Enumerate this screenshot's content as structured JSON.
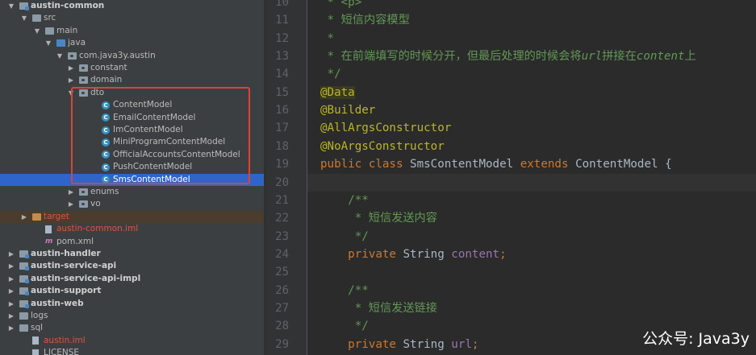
{
  "project_tree": {
    "rows": [
      {
        "label": "austin-common",
        "arrow": "▼",
        "icon": "module",
        "indent": 24,
        "bold": true
      },
      {
        "label": "src",
        "arrow": "▼",
        "icon": "folder",
        "indent": 40
      },
      {
        "label": "main",
        "arrow": "▼",
        "icon": "folder",
        "indent": 56
      },
      {
        "label": "java",
        "arrow": "▼",
        "icon": "src",
        "indent": 70
      },
      {
        "label": "com.java3y.austin",
        "arrow": "▼",
        "icon": "package",
        "indent": 84
      },
      {
        "label": "constant",
        "arrow": "▶",
        "icon": "package",
        "indent": 98
      },
      {
        "label": "domain",
        "arrow": "▶",
        "icon": "package",
        "indent": 98
      },
      {
        "label": "dto",
        "arrow": "▼",
        "icon": "package",
        "indent": 98
      },
      {
        "label": "ContentModel",
        "arrow": "",
        "icon": "java-class",
        "indent": 126
      },
      {
        "label": "EmailContentModel",
        "arrow": "",
        "icon": "java-class",
        "indent": 126
      },
      {
        "label": "ImContentModel",
        "arrow": "",
        "icon": "java-class",
        "indent": 126
      },
      {
        "label": "MiniProgramContentModel",
        "arrow": "",
        "icon": "java-class",
        "indent": 126
      },
      {
        "label": "OfficialAccountsContentModel",
        "arrow": "",
        "icon": "java-class",
        "indent": 126
      },
      {
        "label": "PushContentModel",
        "arrow": "",
        "icon": "java-class",
        "indent": 126
      },
      {
        "label": "SmsContentModel",
        "arrow": "",
        "icon": "java-class",
        "indent": 126,
        "selected": true
      },
      {
        "label": "enums",
        "arrow": "▶",
        "icon": "package",
        "indent": 98
      },
      {
        "label": "vo",
        "arrow": "▶",
        "icon": "package",
        "indent": 98
      },
      {
        "label": "target",
        "arrow": "▶",
        "icon": "target",
        "indent": 40,
        "excluded": true,
        "red": true
      },
      {
        "label": "austin-common.iml",
        "arrow": "",
        "icon": "file",
        "indent": 56,
        "red": true
      },
      {
        "label": "pom.xml",
        "arrow": "",
        "icon": "maven",
        "indent": 56
      },
      {
        "label": "austin-handler",
        "arrow": "▶",
        "icon": "module",
        "indent": 24,
        "bold": true
      },
      {
        "label": "austin-service-api",
        "arrow": "▶",
        "icon": "module",
        "indent": 24,
        "bold": true
      },
      {
        "label": "austin-service-api-impl",
        "arrow": "▶",
        "icon": "module",
        "indent": 24,
        "bold": true
      },
      {
        "label": "austin-support",
        "arrow": "▶",
        "icon": "module",
        "indent": 24,
        "bold": true
      },
      {
        "label": "austin-web",
        "arrow": "▶",
        "icon": "module",
        "indent": 24,
        "bold": true
      },
      {
        "label": "logs",
        "arrow": "▶",
        "icon": "folder",
        "indent": 24
      },
      {
        "label": "sql",
        "arrow": "▶",
        "icon": "folder",
        "indent": 24
      },
      {
        "label": "austin.iml",
        "arrow": "",
        "icon": "file",
        "indent": 40,
        "red": true
      },
      {
        "label": "LICENSE",
        "arrow": "",
        "icon": "file",
        "indent": 40
      }
    ]
  },
  "editor": {
    "current_line": "20",
    "lines": [
      {
        "num": "10",
        "tokens": [
          {
            "t": " * <p>",
            "c": "c-doc"
          }
        ]
      },
      {
        "num": "11",
        "tokens": [
          {
            "t": " * 短信内容模型",
            "c": "c-doc"
          }
        ]
      },
      {
        "num": "12",
        "tokens": [
          {
            "t": " *",
            "c": "c-doc"
          }
        ]
      },
      {
        "num": "13",
        "tokens": [
          {
            "t": " * 在前端填写的时候分开，但最后处理的时候会将",
            "c": "c-doc"
          },
          {
            "t": "url",
            "c": "c-doc c-italic"
          },
          {
            "t": "拼接在",
            "c": "c-doc"
          },
          {
            "t": "content",
            "c": "c-doc c-italic"
          },
          {
            "t": "上",
            "c": "c-doc"
          }
        ]
      },
      {
        "num": "14",
        "tokens": [
          {
            "t": " */",
            "c": "c-doc"
          }
        ]
      },
      {
        "num": "15",
        "tokens": [
          {
            "t": "@Data",
            "c": "c-anno-hl"
          }
        ]
      },
      {
        "num": "16",
        "tokens": [
          {
            "t": "@Builder",
            "c": "c-anno"
          }
        ]
      },
      {
        "num": "17",
        "tokens": [
          {
            "t": "@AllArgsConstructor",
            "c": "c-anno"
          }
        ]
      },
      {
        "num": "18",
        "tokens": [
          {
            "t": "@NoArgsConstructor",
            "c": "c-anno"
          }
        ]
      },
      {
        "num": "19",
        "tokens": [
          {
            "t": "public class ",
            "c": "c-kw"
          },
          {
            "t": "SmsContentModel ",
            "c": "c-plain"
          },
          {
            "t": "extends ",
            "c": "c-kw"
          },
          {
            "t": "ContentModel {",
            "c": "c-plain"
          }
        ]
      },
      {
        "num": "20",
        "tokens": []
      },
      {
        "num": "21",
        "tokens": [
          {
            "t": "    /**",
            "c": "c-doc"
          }
        ]
      },
      {
        "num": "22",
        "tokens": [
          {
            "t": "     * 短信发送内容",
            "c": "c-doc"
          }
        ]
      },
      {
        "num": "23",
        "tokens": [
          {
            "t": "     */",
            "c": "c-doc"
          }
        ]
      },
      {
        "num": "24",
        "tokens": [
          {
            "t": "    private ",
            "c": "c-kw"
          },
          {
            "t": "String ",
            "c": "c-plain"
          },
          {
            "t": "content",
            "c": "c-field"
          },
          {
            "t": ";",
            "c": "c-kw"
          }
        ]
      },
      {
        "num": "25",
        "tokens": []
      },
      {
        "num": "26",
        "tokens": [
          {
            "t": "    /**",
            "c": "c-doc"
          }
        ]
      },
      {
        "num": "27",
        "tokens": [
          {
            "t": "     * 短信发送链接",
            "c": "c-doc"
          }
        ]
      },
      {
        "num": "28",
        "tokens": [
          {
            "t": "     */",
            "c": "c-doc"
          }
        ]
      },
      {
        "num": "29",
        "tokens": [
          {
            "t": "    private ",
            "c": "c-kw"
          },
          {
            "t": "String ",
            "c": "c-plain"
          },
          {
            "t": "url",
            "c": "c-field"
          },
          {
            "t": ";",
            "c": "c-kw"
          }
        ]
      }
    ]
  },
  "watermark": "公众号: Java3y",
  "colors": {
    "selection": "#2f65ca",
    "highlight_box": "#d9443a",
    "doc_comment": "#629755",
    "annotation": "#bbb529",
    "keyword": "#cc7832",
    "field": "#9876aa"
  }
}
